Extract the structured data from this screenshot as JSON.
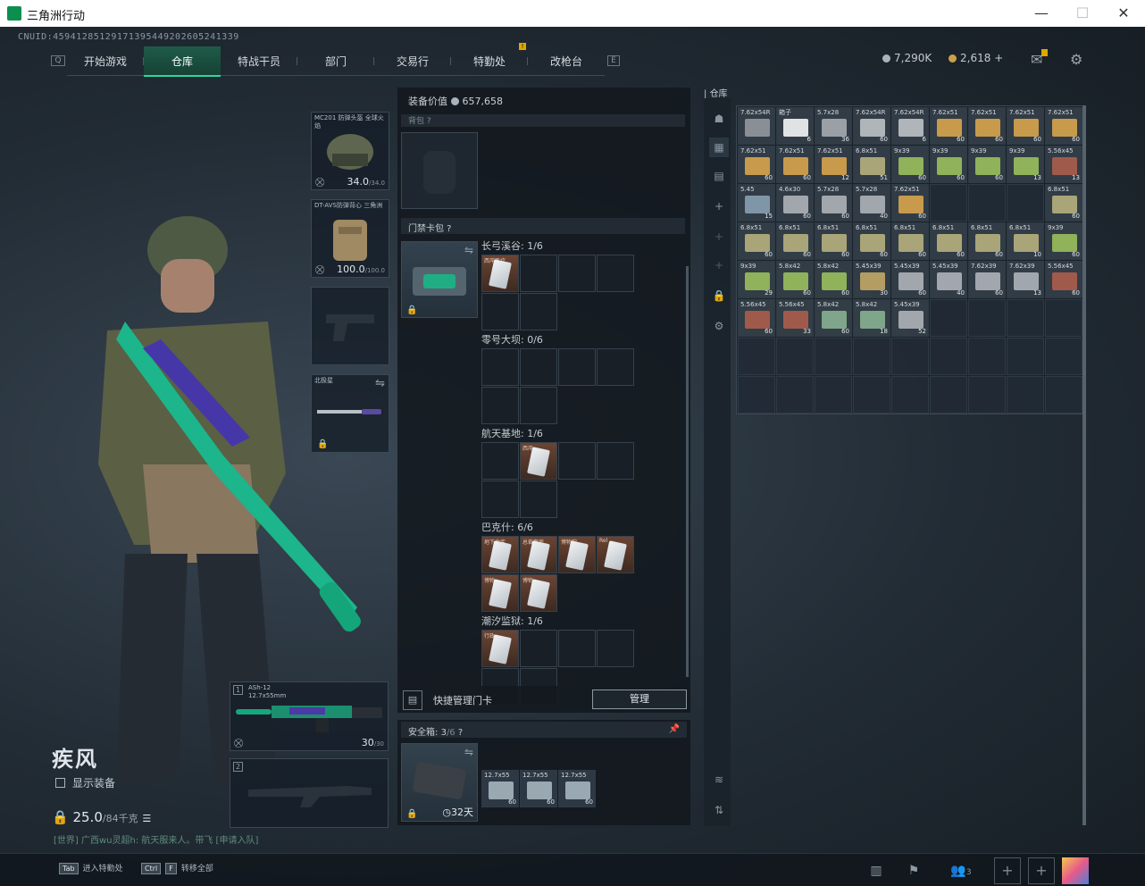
{
  "window": {
    "title": "三角洲行动",
    "minimize": "—",
    "maximize": "☐",
    "close": "✕"
  },
  "uid": "CNUID:459412851291713954492026052413​39",
  "nav": {
    "left_key": "Q",
    "right_key": "E",
    "tabs": [
      {
        "label": "开始游戏"
      },
      {
        "label": "仓库",
        "active": true
      },
      {
        "label": "特战干员"
      },
      {
        "label": "部门"
      },
      {
        "label": "交易行"
      },
      {
        "label": "特勤处",
        "badge": "!"
      },
      {
        "label": "改枪台"
      }
    ]
  },
  "currency": {
    "silver": "7,290K",
    "gold": "2,618",
    "gold_plus": "+"
  },
  "icons": {
    "mail": "mail-icon",
    "settings": "gear-icon"
  },
  "character": {
    "name": "疾风",
    "show_equip_label": "显示装备",
    "weight_value": "25.0",
    "weight_max": "/84千克"
  },
  "chat": {
    "text": "[世界] 广西wu灵超h: 航天服来人。带飞 [申请入队]"
  },
  "equipment": {
    "helmet": {
      "label": "MC201 防弹头盔 全球火焰",
      "durability": "34.0",
      "durability_max": "/34.0"
    },
    "armor": {
      "label": "DT-AVS防弹背心 三角洲",
      "durability": "100.0",
      "durability_max": "/100.0"
    },
    "melee": {
      "label": "北极星"
    },
    "primary": {
      "slot": "1",
      "name": "ASh-12",
      "caliber": "12.7x55mm",
      "ammo": "30",
      "ammo_max": "/30"
    },
    "secondary": {
      "slot": "2"
    }
  },
  "loadout": {
    "value_label": "装备价值",
    "value": "657,658",
    "backpack_label": "背包",
    "keycard_pack_label": "门禁卡包",
    "maps": [
      {
        "name": "长弓溪谷: 1/6"
      },
      {
        "name": "零号大坝: 0/6"
      },
      {
        "name": "航天基地: 1/6"
      },
      {
        "name": "巴克什: 6/6"
      },
      {
        "name": "潮汐监狱: 1/6"
      }
    ],
    "quick_manage_label": "快捷管理门卡",
    "manage_button": "管理",
    "safe_label": "安全箱:",
    "safe_count": "3",
    "safe_max": "/6",
    "safe_days": "32天",
    "safe_items": [
      {
        "tag": "12.7x55",
        "qty": "60"
      },
      {
        "tag": "12.7x55",
        "qty": "60"
      },
      {
        "tag": "12.7x55",
        "qty": "60"
      }
    ]
  },
  "keycard_labels": {
    "card1": "西岸医疗",
    "card2": "西岸",
    "card3": "地下金库",
    "card4": "总裁套房",
    "card5": "博物馆",
    "card6": "Rel",
    "card7": "博物",
    "card8": "博物",
    "card9": "行政"
  },
  "warehouse": {
    "title": "仓库",
    "rows": [
      [
        {
          "t": "7.62x54R",
          "q": "",
          "c": "#8a8f95"
        },
        {
          "t": "箱子",
          "q": "6",
          "c": "#e0e2e4"
        },
        {
          "t": "5.7x28",
          "q": "36",
          "c": "#9aa0a6"
        },
        {
          "t": "7.62x54R",
          "q": "60",
          "c": "#b0b5ba"
        },
        {
          "t": "7.62x54R",
          "q": "6",
          "c": "#b0b5ba"
        },
        {
          "t": "7.62x51",
          "q": "60",
          "c": "#c79a4c"
        },
        {
          "t": "7.62x51",
          "q": "60",
          "c": "#c79a4c"
        },
        {
          "t": "7.62x51",
          "q": "60",
          "c": "#c79a4c"
        },
        {
          "t": "7.62x51",
          "q": "60",
          "c": "#c79a4c"
        }
      ],
      [
        {
          "t": "7.62x51",
          "q": "60",
          "c": "#c79a4c"
        },
        {
          "t": "7.62x51",
          "q": "60",
          "c": "#c79a4c"
        },
        {
          "t": "7.62x51",
          "q": "12",
          "c": "#c79a4c"
        },
        {
          "t": "6.8x51",
          "q": "51",
          "c": "#a9a579"
        },
        {
          "t": "9x39",
          "q": "60",
          "c": "#8fb25a"
        },
        {
          "t": "9x39",
          "q": "60",
          "c": "#8fb25a"
        },
        {
          "t": "9x39",
          "q": "60",
          "c": "#8fb25a"
        },
        {
          "t": "9x39",
          "q": "13",
          "c": "#8fb25a"
        },
        {
          "t": "5.56x45",
          "q": "13",
          "c": "#a05a4c"
        }
      ],
      [
        {
          "t": "5.45",
          "q": "15",
          "c": "#7f96a8"
        },
        {
          "t": "4.6x30",
          "q": "60",
          "c": "#a1a7ac"
        },
        {
          "t": "5.7x28",
          "q": "60",
          "c": "#a1a7ac"
        },
        {
          "t": "5.7x28",
          "q": "40",
          "c": "#a1a7ac"
        },
        {
          "t": "7.62x51",
          "q": "60",
          "c": "#c79a4c"
        },
        {
          "t": "",
          "q": "",
          "c": ""
        },
        {
          "t": "",
          "q": "",
          "c": ""
        },
        {
          "t": "",
          "q": "",
          "c": ""
        },
        {
          "t": "6.8x51",
          "q": "60",
          "c": "#a9a579"
        }
      ],
      [
        {
          "t": "6.8x51",
          "q": "60",
          "c": "#a9a579"
        },
        {
          "t": "6.8x51",
          "q": "60",
          "c": "#a9a579"
        },
        {
          "t": "6.8x51",
          "q": "60",
          "c": "#a9a579"
        },
        {
          "t": "6.8x51",
          "q": "60",
          "c": "#a9a579"
        },
        {
          "t": "6.8x51",
          "q": "60",
          "c": "#a9a579"
        },
        {
          "t": "6.8x51",
          "q": "60",
          "c": "#a9a579"
        },
        {
          "t": "6.8x51",
          "q": "60",
          "c": "#a9a579"
        },
        {
          "t": "6.8x51",
          "q": "10",
          "c": "#a9a579"
        },
        {
          "t": "9x39",
          "q": "60",
          "c": "#8fb25a"
        }
      ],
      [
        {
          "t": "9x39",
          "q": "29",
          "c": "#8fb25a"
        },
        {
          "t": "5.8x42",
          "q": "60",
          "c": "#8fb25a"
        },
        {
          "t": "5.8x42",
          "q": "60",
          "c": "#8fb25a"
        },
        {
          "t": "5.45x39",
          "q": "30",
          "c": "#b39d62"
        },
        {
          "t": "5.45x39",
          "q": "60",
          "c": "#a1a7ac"
        },
        {
          "t": "5.45x39",
          "q": "40",
          "c": "#a1a7ac"
        },
        {
          "t": "7.62x39",
          "q": "60",
          "c": "#a1a7ac"
        },
        {
          "t": "7.62x39",
          "q": "13",
          "c": "#a1a7ac"
        },
        {
          "t": "5.56x45",
          "q": "60",
          "c": "#a05a4c"
        }
      ],
      [
        {
          "t": "5.56x45",
          "q": "60",
          "c": "#a05a4c"
        },
        {
          "t": "5.56x45",
          "q": "33",
          "c": "#a05a4c"
        },
        {
          "t": "5.8x42",
          "q": "60",
          "c": "#7fa58a"
        },
        {
          "t": "5.8x42",
          "q": "18",
          "c": "#7fa58a"
        },
        {
          "t": "5.45x39",
          "q": "52",
          "c": "#a1a7ac"
        },
        {
          "t": "",
          "q": "",
          "c": ""
        },
        {
          "t": "",
          "q": "",
          "c": ""
        },
        {
          "t": "",
          "q": "",
          "c": ""
        },
        {
          "t": "",
          "q": "",
          "c": ""
        }
      ],
      [
        {
          "t": "",
          "q": "",
          "c": ""
        },
        {
          "t": "",
          "q": "",
          "c": ""
        },
        {
          "t": "",
          "q": "",
          "c": ""
        },
        {
          "t": "",
          "q": "",
          "c": ""
        },
        {
          "t": "",
          "q": "",
          "c": ""
        },
        {
          "t": "",
          "q": "",
          "c": ""
        },
        {
          "t": "",
          "q": "",
          "c": ""
        },
        {
          "t": "",
          "q": "",
          "c": ""
        },
        {
          "t": "",
          "q": "",
          "c": ""
        }
      ],
      [
        {
          "t": "",
          "q": "",
          "c": ""
        },
        {
          "t": "",
          "q": "",
          "c": ""
        },
        {
          "t": "",
          "q": "",
          "c": ""
        },
        {
          "t": "",
          "q": "",
          "c": ""
        },
        {
          "t": "",
          "q": "",
          "c": ""
        },
        {
          "t": "",
          "q": "",
          "c": ""
        },
        {
          "t": "",
          "q": "",
          "c": ""
        },
        {
          "t": "",
          "q": "",
          "c": ""
        },
        {
          "t": "",
          "q": "",
          "c": ""
        }
      ]
    ]
  },
  "bottom": {
    "tab_key": "Tab",
    "tab_label": "进入特勤处",
    "ctrl_key": "Ctrl",
    "f_key": "F",
    "transfer_label": "转移全部",
    "squad_count": "3"
  },
  "colors": {
    "accent": "#2fd79b",
    "badge": "#e0a600"
  }
}
